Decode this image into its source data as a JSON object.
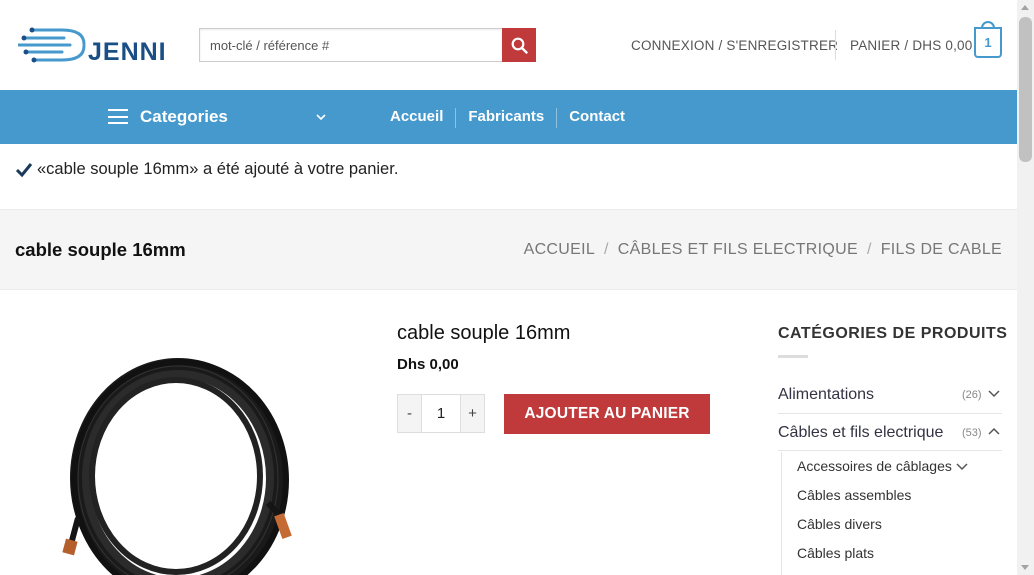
{
  "header": {
    "logo_text": "JENNI",
    "search_placeholder": "mot-clé / référence #",
    "account_link": "CONNEXION / S'ENREGISTRER",
    "cart_link": "PANIER / DHS 0,00",
    "cart_count": "1"
  },
  "nav": {
    "categories_label": "Categories",
    "items": [
      {
        "label": "Accueil"
      },
      {
        "label": "Fabricants"
      },
      {
        "label": "Contact"
      }
    ]
  },
  "notice": {
    "message": "«cable souple 16mm» a été ajouté à votre panier."
  },
  "title_bar": {
    "title": "cable souple 16mm",
    "breadcrumb": [
      "ACCUEIL",
      "CÂBLES ET FILS ELECTRIQUE",
      "FILS DE CABLE"
    ]
  },
  "product": {
    "name": "cable souple 16mm",
    "price": "Dhs 0,00",
    "quantity": "1",
    "minus": "-",
    "plus": "+",
    "add_to_cart": "AJOUTER AU PANIER"
  },
  "sidebar": {
    "title": "CATÉGORIES DE PRODUITS",
    "categories": [
      {
        "label": "Alimentations",
        "count": "(26)"
      },
      {
        "label": "Câbles et fils electrique",
        "count": "(53)"
      }
    ],
    "subcategories": [
      {
        "label": "Accessoires de câblages"
      },
      {
        "label": "Câbles assembles"
      },
      {
        "label": "Câbles divers"
      },
      {
        "label": "Câbles plats"
      }
    ]
  },
  "colors": {
    "nav_blue": "#4699cc",
    "accent_red": "#c0393b",
    "logo_blue": "#1a4f86"
  }
}
